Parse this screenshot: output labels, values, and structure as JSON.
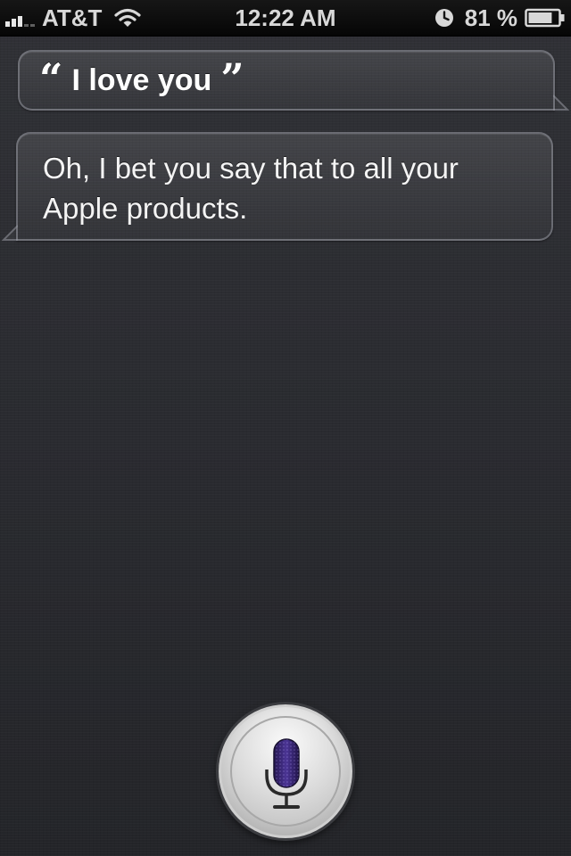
{
  "status_bar": {
    "carrier": "AT&T",
    "time": "12:22 AM",
    "battery_percent": "81 %",
    "signal_bars_on": 3,
    "signal_bars_total": 5,
    "battery_level": 0.81,
    "icons": [
      "signal-icon",
      "wifi-icon",
      "clock-icon",
      "battery-icon"
    ]
  },
  "conversation": {
    "user_query": "I love you",
    "siri_reply": "Oh, I bet you say that to all your Apple products."
  },
  "quotes": {
    "open": "“",
    "close": "”"
  },
  "mic_button": {
    "icon": "microphone-icon"
  },
  "colors": {
    "background": "#2b2c31",
    "status_bar": "#0a0a0a",
    "mic_accent": "#3c2a78",
    "text": "#ffffff"
  }
}
